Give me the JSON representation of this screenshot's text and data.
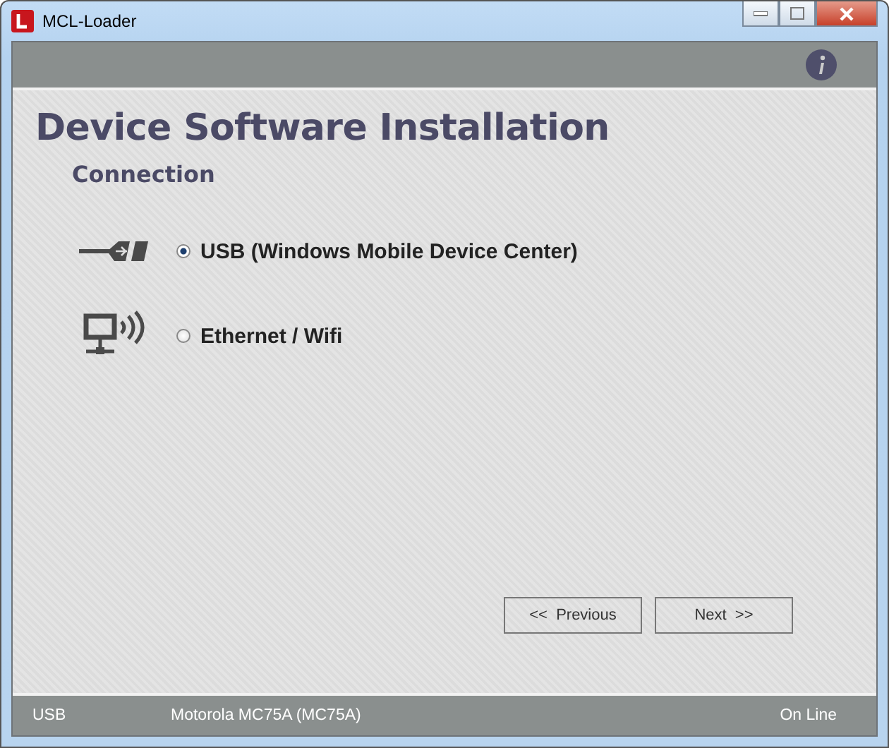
{
  "window": {
    "title": "MCL-Loader"
  },
  "heading": "Device Software Installation",
  "subheading": "Connection",
  "options": [
    {
      "kind": "usb",
      "label": "USB  (Windows Mobile Device Center)",
      "selected": true
    },
    {
      "kind": "network",
      "label": "Ethernet / Wifi",
      "selected": false
    }
  ],
  "buttons": [
    {
      "label": "<<  Previous"
    },
    {
      "label": "Next  >>"
    }
  ],
  "status_bar": {
    "connection": "USB",
    "device": "Motorola MC75A (MC75A)",
    "state": "On Line"
  }
}
